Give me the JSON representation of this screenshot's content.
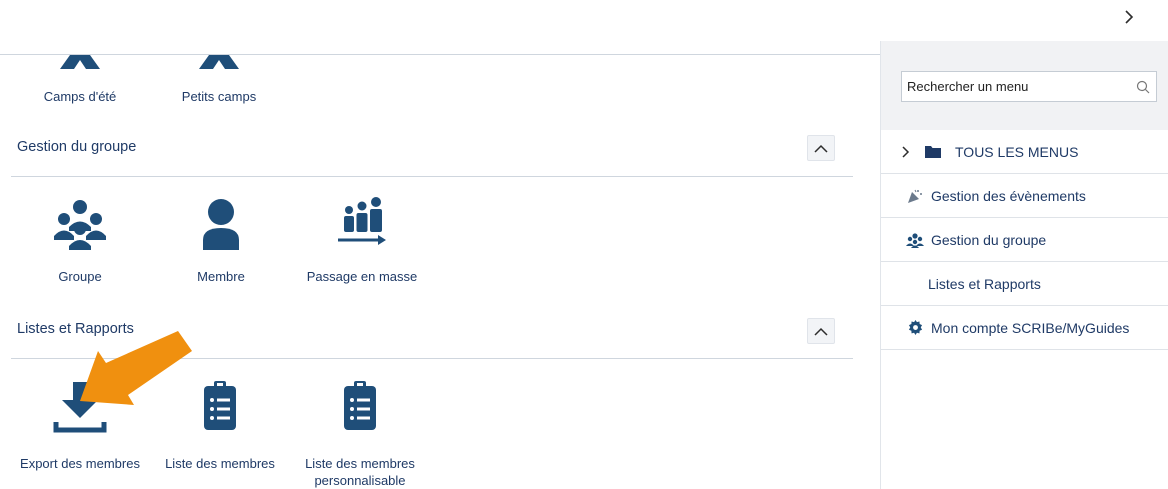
{
  "header": {
    "expand_icon": "chevron-right-icon"
  },
  "top_tiles": [
    {
      "label": "Camps d'été",
      "icon": "tent-icon"
    },
    {
      "label": "Petits camps",
      "icon": "tent-icon"
    }
  ],
  "sections": [
    {
      "title": "Gestion du groupe",
      "collapse_icon": "chevron-up-icon",
      "tiles": [
        {
          "label": "Groupe",
          "icon": "group-icon"
        },
        {
          "label": "Membre",
          "icon": "person-icon"
        },
        {
          "label": "Passage en masse",
          "icon": "bulk-move-icon"
        }
      ]
    },
    {
      "title": "Listes et Rapports",
      "collapse_icon": "chevron-up-icon",
      "tiles": [
        {
          "label": "Export des membres",
          "icon": "download-icon"
        },
        {
          "label": "Liste des membres",
          "icon": "clipboard-list-icon"
        },
        {
          "label_line1": "Liste des membres",
          "label_line2": "personnalisable",
          "icon": "clipboard-list-icon"
        }
      ]
    }
  ],
  "annotation": {
    "icon": "arrow-pointer-icon",
    "color": "#f0900f"
  },
  "sidebar": {
    "search_placeholder": "Rechercher un menu",
    "search_icon": "search-icon",
    "items": [
      {
        "label": "TOUS LES MENUS",
        "icon": "folder-icon"
      },
      {
        "label": "Gestion des évènements",
        "icon": "party-popper-icon"
      },
      {
        "label": "Gestion du groupe",
        "icon": "group-icon"
      },
      {
        "label": "Listes et Rapports",
        "icon": ""
      },
      {
        "label": "Mon compte SCRIBe/MyGuides",
        "icon": "gear-icon"
      }
    ]
  },
  "colors": {
    "brand_navy": "#1f4e79",
    "text": "#1f3a66",
    "accent_orange": "#f0900f"
  }
}
